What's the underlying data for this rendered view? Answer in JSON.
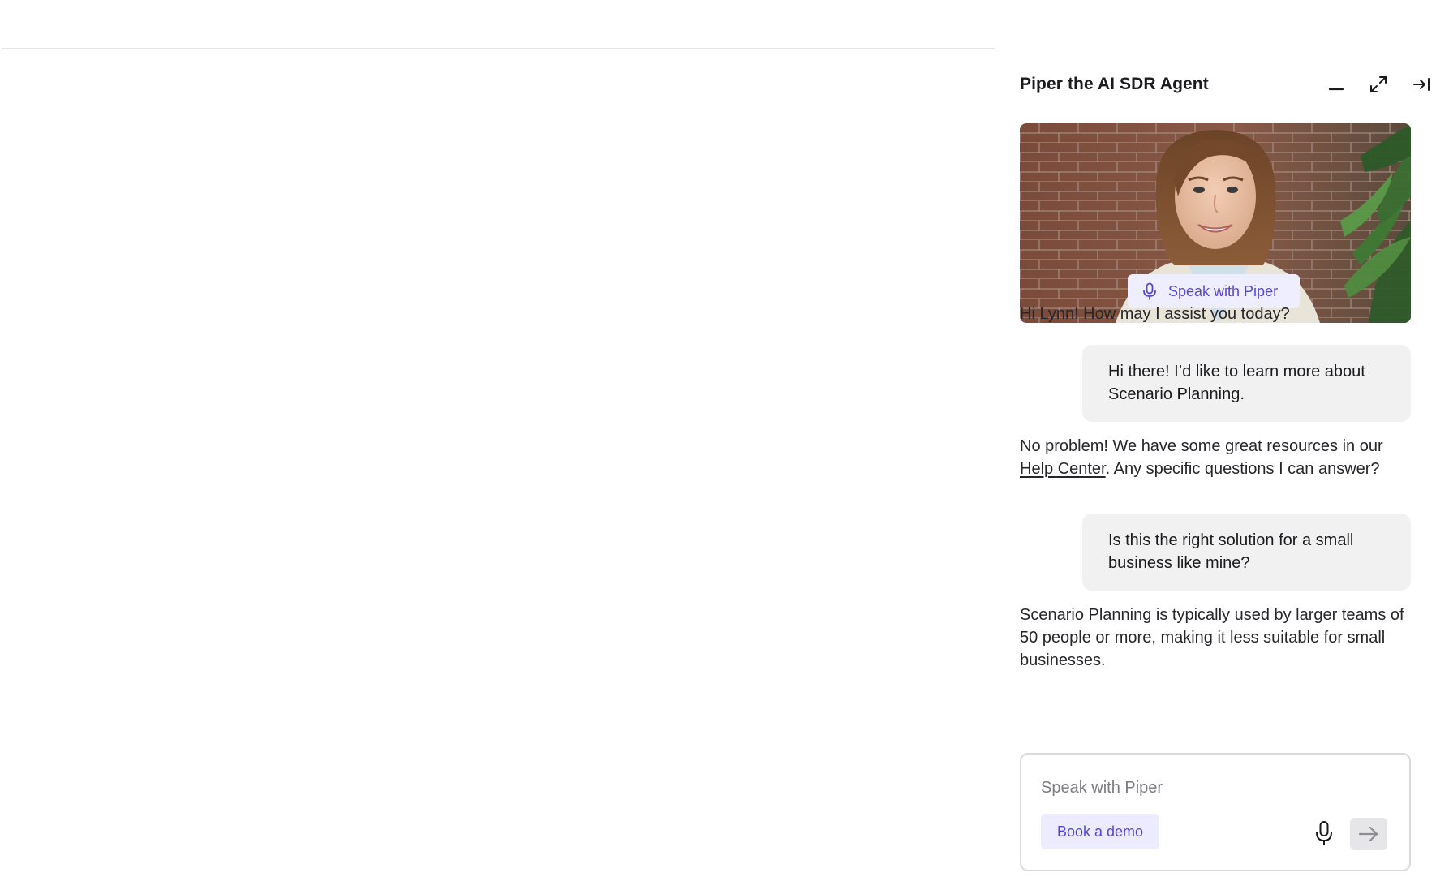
{
  "panel": {
    "title": "Piper the AI SDR Agent",
    "header_icons": [
      "minimize-icon",
      "expand-icon",
      "collapse-right-icon"
    ]
  },
  "hero": {
    "speak_label": "Speak with Piper",
    "icon": "microphone-icon"
  },
  "messages": [
    {
      "role": "agent",
      "text": "Hi Lynn! How may I assist you today?"
    },
    {
      "role": "user",
      "text": "Hi there! I’d like to learn more about Scenario Planning."
    },
    {
      "role": "agent",
      "text_before": "No problem! We have some great resources in our ",
      "link": "Help Center",
      "text_after": ". Any specific questions I can answer?"
    },
    {
      "role": "user",
      "text": "Is this the right solution for a small business like mine?"
    },
    {
      "role": "agent",
      "text": "Scenario Planning is typically used by larger teams of 50 people or more, making it less suitable for small businesses."
    }
  ],
  "composer": {
    "placeholder": "Speak with Piper",
    "value": "",
    "demo_label": "Book a demo",
    "mic_icon": "microphone-icon",
    "send_icon": "arrow-right-icon"
  },
  "colors": {
    "accent": "#5547d6",
    "accent_bg": "#ecebff",
    "user_bubble": "#f1f1f1"
  }
}
